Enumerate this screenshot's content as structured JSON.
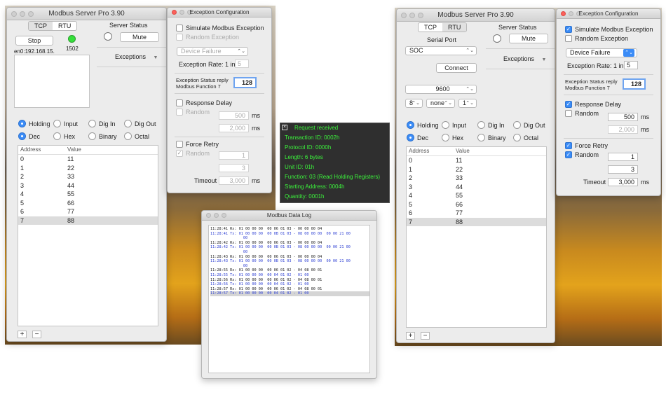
{
  "left": {
    "main_window": {
      "title": "Modbus Server Pro 3.90",
      "tabs": [
        "TCP",
        "RTU"
      ],
      "stop_label": "Stop",
      "port": "1502",
      "address_text": "en0:192.168.15.",
      "server_status_label": "Server Status",
      "mute_label": "Mute",
      "exceptions_label": "Exceptions",
      "register_types": [
        "Holding",
        "Input",
        "Dig In",
        "Dig Out"
      ],
      "formats": [
        "Dec",
        "Hex",
        "Binary",
        "Octal"
      ],
      "columns": [
        "Address",
        "Value"
      ],
      "rows": [
        [
          "0",
          "11"
        ],
        [
          "1",
          "22"
        ],
        [
          "2",
          "33"
        ],
        [
          "3",
          "44"
        ],
        [
          "4",
          "55"
        ],
        [
          "5",
          "66"
        ],
        [
          "6",
          "77"
        ],
        [
          "7",
          "88"
        ]
      ],
      "add_label": "+",
      "remove_label": "−"
    },
    "exception_window": {
      "title": "Exception Configuration",
      "simulate_label": "Simulate Modbus Exception",
      "random_exception_label": "Random Exception",
      "exception_type": "Device Failure",
      "rate_label": "Exception Rate: 1 in",
      "rate_value": "5",
      "status_label_1": "Exception Status reply",
      "status_label_2": "Modbus Function 7",
      "status_value": "128",
      "response_delay_label": "Response Delay",
      "random_label": "Random",
      "delay_value": "500",
      "delay_max": "2,000",
      "ms": "ms",
      "force_retry_label": "Force Retry",
      "retry_value": "1",
      "retry_max": "3",
      "timeout_label": "Timeout",
      "timeout_value": "3,000"
    }
  },
  "tooltip": {
    "lines": [
      "Request received",
      "Transaction ID: 0002h",
      "Protocol ID: 0000h",
      "Length: 6 bytes",
      "Unit ID: 01h",
      "Function: 03 (Read Holding Registers)",
      "Starting Address: 0004h",
      "Quantity: 0001h"
    ],
    "close_icon": "close-icon"
  },
  "data_log": {
    "title": "Modbus Data Log",
    "lines": [
      {
        "text": "11:28:41 Rx: 01 00 00 00  00 06 01 03 - 00 00 00 04",
        "kind": "rx"
      },
      {
        "text": "11:28:41 Tx: 01 00 00 00  00 0B 01 03 - 08 00 00 00  00 00 21 00",
        "kind": "tx"
      },
      {
        "text": "               00",
        "kind": "tx"
      },
      {
        "text": "11:28:42 Rx: 01 00 00 00  00 06 01 03 - 00 00 00 04",
        "kind": "rx"
      },
      {
        "text": "11:28:42 Tx: 01 00 00 00  00 0B 01 03 - 08 00 00 00  00 00 21 00",
        "kind": "tx"
      },
      {
        "text": "               00",
        "kind": "tx"
      },
      {
        "text": "11:28:43 Rx: 01 00 00 00  00 06 01 03 - 00 00 00 04",
        "kind": "rx"
      },
      {
        "text": "11:28:43 Tx: 01 00 00 00  00 0B 01 03 - 08 00 00 00  00 00 21 00",
        "kind": "tx"
      },
      {
        "text": "               00",
        "kind": "tx"
      },
      {
        "text": "11:28:55 Rx: 01 00 00 00  00 06 01 02 - 04 08 00 01",
        "kind": "rx"
      },
      {
        "text": "11:28:55 Tx: 01 00 00 00  00 04 01 02 - 01 00",
        "kind": "tx"
      },
      {
        "text": "11:28:56 Rx: 01 00 00 00  00 06 01 02 - 04 08 00 01",
        "kind": "rx"
      },
      {
        "text": "11:28:56 Tx: 01 00 00 00  00 04 01 02 - 01 00",
        "kind": "tx"
      },
      {
        "text": "11:28:57 Rx: 01 00 00 00  00 06 01 02 - 04 08 00 01",
        "kind": "rx"
      },
      {
        "text": "11:28:57 Tx: 01 00 00 00  00 04 01 02 - 01 00",
        "kind": "tx hl"
      }
    ]
  },
  "right": {
    "main_window": {
      "title": "Modbus Server Pro 3.90",
      "tabs": [
        "TCP",
        "RTU"
      ],
      "serial_port_label": "Serial Port",
      "serial_port_value": "SOC",
      "connect_label": "Connect",
      "baud": "9600",
      "data_bits": "8",
      "parity": "none",
      "stop_bits": "1",
      "server_status_label": "Server Status",
      "mute_label": "Mute",
      "exceptions_label": "Exceptions",
      "register_types": [
        "Holding",
        "Input",
        "Dig In",
        "Dig Out"
      ],
      "formats": [
        "Dec",
        "Hex",
        "Binary",
        "Octal"
      ],
      "columns": [
        "Address",
        "Value"
      ],
      "rows": [
        [
          "0",
          "11"
        ],
        [
          "1",
          "22"
        ],
        [
          "2",
          "33"
        ],
        [
          "3",
          "44"
        ],
        [
          "4",
          "55"
        ],
        [
          "5",
          "66"
        ],
        [
          "6",
          "77"
        ],
        [
          "7",
          "88"
        ]
      ],
      "add_label": "+",
      "remove_label": "−"
    },
    "exception_window": {
      "title": "Exception Configuration",
      "simulate_label": "Simulate Modbus Exception",
      "random_exception_label": "Random Exception",
      "exception_type": "Device Failure",
      "rate_label": "Exception Rate: 1 in",
      "rate_value": "5",
      "status_label_1": "Exception Status reply",
      "status_label_2": "Modbus Function 7",
      "status_value": "128",
      "response_delay_label": "Response Delay",
      "random_label": "Random",
      "delay_value": "500",
      "delay_max": "2,000",
      "ms": "ms",
      "force_retry_label": "Force Retry",
      "retry_value": "1",
      "retry_max": "3",
      "timeout_label": "Timeout",
      "timeout_value": "3,000"
    }
  }
}
